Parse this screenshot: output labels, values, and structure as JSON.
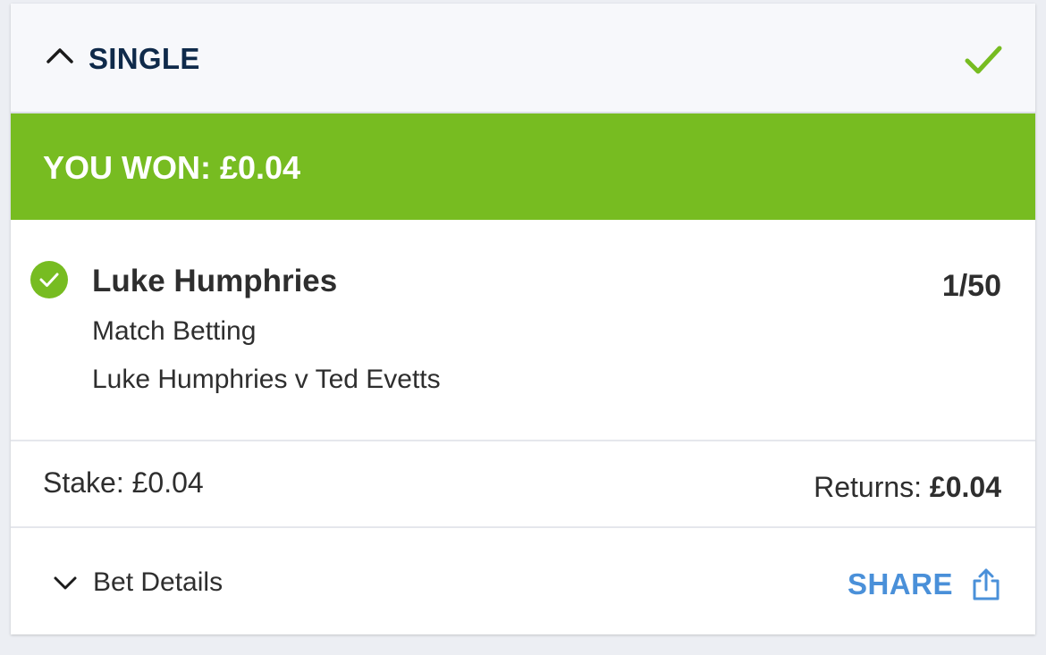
{
  "header": {
    "title": "SINGLE",
    "collapse_icon": "chevron-up-icon",
    "status_icon": "checkmark-icon"
  },
  "result": {
    "banner_text": "YOU WON: £0.04"
  },
  "selection": {
    "status_icon": "check-circle-icon",
    "name": "Luke Humphries",
    "odds": "1/50",
    "market": "Match Betting",
    "event": "Luke Humphries v Ted Evetts"
  },
  "summary": {
    "stake_label": "Stake: ",
    "stake_value": "£0.04",
    "returns_label": "Returns: ",
    "returns_value": "£0.04"
  },
  "footer": {
    "details_label": "Bet Details",
    "details_icon": "chevron-down-icon",
    "share_label": "SHARE",
    "share_icon": "share-icon"
  },
  "colors": {
    "win_green": "#77bc21",
    "navy": "#0f2a4a",
    "link_blue": "#4a90d9",
    "text": "#2e2e2e"
  }
}
